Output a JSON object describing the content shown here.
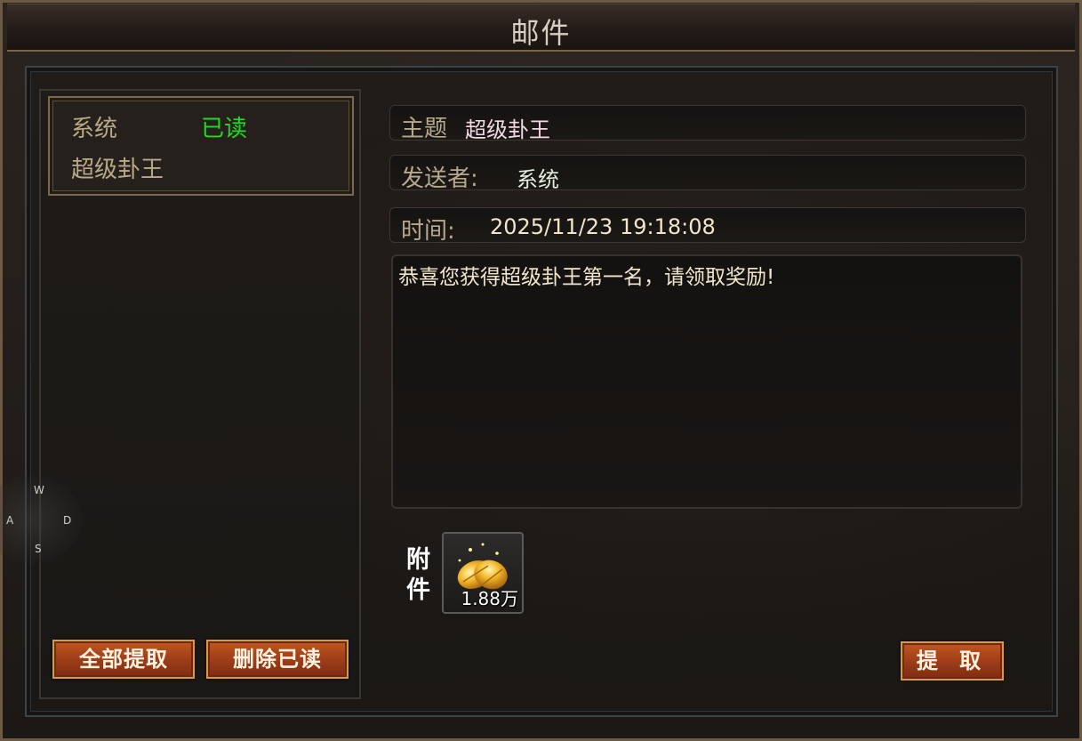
{
  "window": {
    "title": "邮件"
  },
  "mail_list": [
    {
      "sender": "系统",
      "status": "已读",
      "subject": "超级卦王"
    }
  ],
  "buttons": {
    "claim_all": "全部提取",
    "delete_read": "删除已读",
    "claim": "提 取"
  },
  "detail": {
    "subject_label": "主题",
    "subject_value": "超级卦王",
    "sender_label": "发送者:",
    "sender_value": "系统",
    "time_label": "时间:",
    "time_value": "2025/11/23 19:18:08",
    "body": "恭喜您获得超级卦王第一名，请领取奖励!"
  },
  "attachment": {
    "label": "附件",
    "item_icon": "gold-leaf-icon",
    "count": "1.88万"
  },
  "wasd": {
    "w": "W",
    "a": "A",
    "s": "S",
    "d": "D"
  },
  "colors": {
    "read_status": "#22d922",
    "button_orange": "#b04a1c",
    "frame_gold": "#7d6a4c"
  }
}
